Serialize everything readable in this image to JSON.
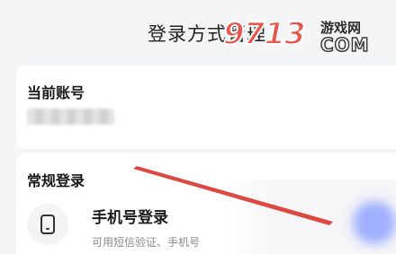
{
  "header": {
    "title": "登录方式管理"
  },
  "account": {
    "section_title": "当前账号"
  },
  "login": {
    "section_title": "常规登录",
    "option": {
      "title": "手机号登录",
      "description": "可用短信验证、手机号"
    }
  },
  "watermark": {
    "number": "9713",
    "site": "游戏网",
    "domain": "COM"
  },
  "colors": {
    "background": "#f4f5f7",
    "card": "#ffffff",
    "watermark_red": "#e8574b",
    "arrow_red": "#d9342b"
  },
  "icons": {
    "login_option": "phone-icon"
  }
}
